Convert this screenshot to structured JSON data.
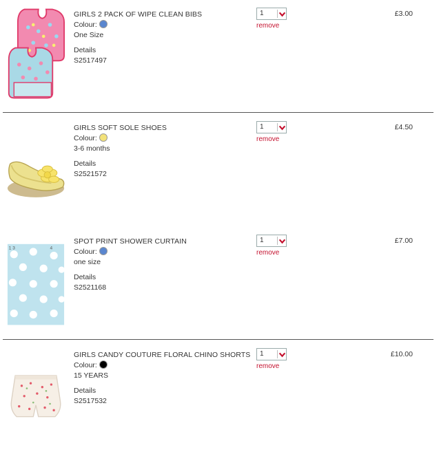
{
  "labels": {
    "colour": "Colour:",
    "details": "Details",
    "remove": "remove"
  },
  "items": [
    {
      "title": "GIRLS 2 PACK OF WIPE CLEAN BIBS",
      "colour_hex": "#5a86cf",
      "size": "One Size",
      "code": "S2517497",
      "qty": "1",
      "price": "£3.00"
    },
    {
      "title": "GIRLS SOFT SOLE SHOES",
      "colour_hex": "#f3e27a",
      "size": "3-6 months",
      "code": "S2521572",
      "qty": "1",
      "price": "£4.50"
    },
    {
      "title": "SPOT PRINT SHOWER CURTAIN",
      "colour_hex": "#5a86cf",
      "size": "one size",
      "code": "S2521168",
      "qty": "1",
      "price": "£7.00"
    },
    {
      "title": "GIRLS CANDY COUTURE FLORAL CHINO SHORTS",
      "colour_hex": "#000000",
      "size": "15 YEARS",
      "code": "S2517532",
      "qty": "1",
      "price": "£10.00"
    }
  ],
  "icons": {
    "quantity_dropdown": "chevron-down-icon",
    "colour_swatch": "swatch-circle"
  },
  "colors": {
    "remove_link": "#c4122f",
    "divider": "#555555",
    "chevron": "#c4122f"
  }
}
